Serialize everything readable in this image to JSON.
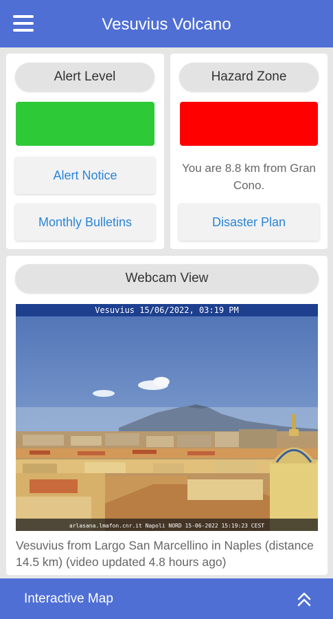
{
  "app": {
    "title": "Vesuvius Volcano"
  },
  "alert": {
    "heading": "Alert Level",
    "status_color": "#2ec937",
    "notice_label": "Alert Notice",
    "bulletins_label": "Monthly Bulletins"
  },
  "hazard": {
    "heading": "Hazard Zone",
    "status_color": "#ff0000",
    "distance_text": "You are 8.8 km from Gran Cono.",
    "plan_label": "Disaster Plan"
  },
  "webcam": {
    "heading": "Webcam View",
    "overlay_top": "Vesuvius   15/06/2022, 03:19 PM",
    "overlay_bottom": "arlasana.lmafon.cnr.it  Napoli NORD 15-06-2022 15:19:23 CEST",
    "caption": "Vesuvius from Largo San Marcellino in Naples (distance 14.5 km) (video updated 4.8 hours ago)"
  },
  "bottom": {
    "label": "Interactive Map"
  },
  "colors": {
    "accent": "#4f6fd4",
    "link": "#2a85d8"
  }
}
